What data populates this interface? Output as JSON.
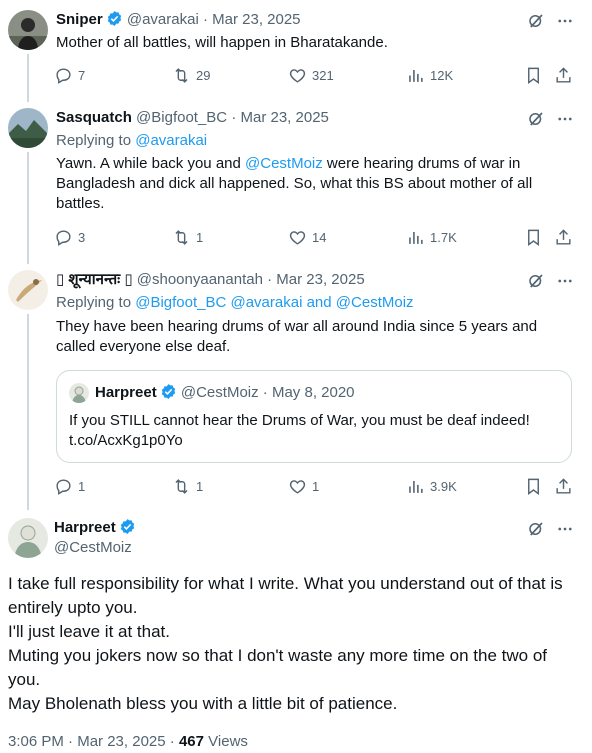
{
  "tweets": [
    {
      "name": "Sniper",
      "handle": "@avarakai",
      "date": "Mar 23, 2025",
      "text": "Mother of all battles, will happen in Bharatakande.",
      "stats": {
        "replies": "7",
        "retweets": "29",
        "likes": "321",
        "views": "12K"
      }
    },
    {
      "name": "Sasquatch",
      "handle": "@Bigfoot_BC",
      "date": "Mar 23, 2025",
      "reply_prefix": "Replying to",
      "reply_to": "@avarakai",
      "text_parts": [
        "Yawn. A while back you and ",
        "@CestMoiz",
        " were hearing drums of war in Bangladesh and dick all happened. So, what this BS about mother of all battles."
      ],
      "stats": {
        "replies": "3",
        "retweets": "1",
        "likes": "14",
        "views": "1.7K"
      }
    },
    {
      "name": "▯ शून्यानन्तः ▯",
      "handle": "@shoonyaanantah",
      "date": "Mar 23, 2025",
      "reply_prefix": "Replying to",
      "reply_to": "@Bigfoot_BC @avarakai",
      "reply_and": "and",
      "reply_to2": "@CestMoiz",
      "text": "They have been hearing drums of war all around India since 5 years and called everyone else deaf.",
      "quote": {
        "name": "Harpreet",
        "handle": "@CestMoiz",
        "date": "May 8, 2020",
        "text": "If you STILL cannot hear the Drums of War, you must be deaf indeed! t.co/AcxKg1p0Yo"
      },
      "stats": {
        "replies": "1",
        "retweets": "1",
        "likes": "1",
        "views": "3.9K"
      }
    }
  ],
  "main": {
    "name": "Harpreet",
    "handle": "@CestMoiz",
    "lines": [
      "I take full responsibility for what I write. What you understand out of that is entirely upto you.",
      "I'll just leave it at that.",
      "Muting you jokers now so that I don't waste any more time on the two of you.",
      "May Bholenath bless you with a little bit of patience."
    ],
    "time": "3:06 PM",
    "date": "Mar 23, 2025",
    "views": "467",
    "views_label": "Views"
  },
  "colors": {
    "accent": "#1d9bf0",
    "muted": "#536471",
    "border": "#cfd9de"
  },
  "icons": [
    "reply-icon",
    "retweet-icon",
    "like-icon",
    "views-icon",
    "bookmark-icon",
    "share-icon",
    "grok-icon",
    "more-icon",
    "verified-icon"
  ]
}
